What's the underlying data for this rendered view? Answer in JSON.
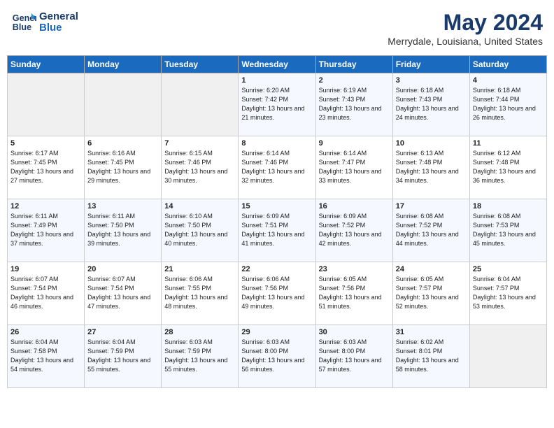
{
  "header": {
    "logo_line1": "General",
    "logo_line2": "Blue",
    "title": "May 2024",
    "subtitle": "Merrydale, Louisiana, United States"
  },
  "days_of_week": [
    "Sunday",
    "Monday",
    "Tuesday",
    "Wednesday",
    "Thursday",
    "Friday",
    "Saturday"
  ],
  "weeks": [
    [
      {
        "day": "",
        "empty": true
      },
      {
        "day": "",
        "empty": true
      },
      {
        "day": "",
        "empty": true
      },
      {
        "day": "1",
        "sunrise": "6:20 AM",
        "sunset": "7:42 PM",
        "daylight": "13 hours and 21 minutes."
      },
      {
        "day": "2",
        "sunrise": "6:19 AM",
        "sunset": "7:43 PM",
        "daylight": "13 hours and 23 minutes."
      },
      {
        "day": "3",
        "sunrise": "6:18 AM",
        "sunset": "7:43 PM",
        "daylight": "13 hours and 24 minutes."
      },
      {
        "day": "4",
        "sunrise": "6:18 AM",
        "sunset": "7:44 PM",
        "daylight": "13 hours and 26 minutes."
      }
    ],
    [
      {
        "day": "5",
        "sunrise": "6:17 AM",
        "sunset": "7:45 PM",
        "daylight": "13 hours and 27 minutes."
      },
      {
        "day": "6",
        "sunrise": "6:16 AM",
        "sunset": "7:45 PM",
        "daylight": "13 hours and 29 minutes."
      },
      {
        "day": "7",
        "sunrise": "6:15 AM",
        "sunset": "7:46 PM",
        "daylight": "13 hours and 30 minutes."
      },
      {
        "day": "8",
        "sunrise": "6:14 AM",
        "sunset": "7:46 PM",
        "daylight": "13 hours and 32 minutes."
      },
      {
        "day": "9",
        "sunrise": "6:14 AM",
        "sunset": "7:47 PM",
        "daylight": "13 hours and 33 minutes."
      },
      {
        "day": "10",
        "sunrise": "6:13 AM",
        "sunset": "7:48 PM",
        "daylight": "13 hours and 34 minutes."
      },
      {
        "day": "11",
        "sunrise": "6:12 AM",
        "sunset": "7:48 PM",
        "daylight": "13 hours and 36 minutes."
      }
    ],
    [
      {
        "day": "12",
        "sunrise": "6:11 AM",
        "sunset": "7:49 PM",
        "daylight": "13 hours and 37 minutes."
      },
      {
        "day": "13",
        "sunrise": "6:11 AM",
        "sunset": "7:50 PM",
        "daylight": "13 hours and 39 minutes."
      },
      {
        "day": "14",
        "sunrise": "6:10 AM",
        "sunset": "7:50 PM",
        "daylight": "13 hours and 40 minutes."
      },
      {
        "day": "15",
        "sunrise": "6:09 AM",
        "sunset": "7:51 PM",
        "daylight": "13 hours and 41 minutes."
      },
      {
        "day": "16",
        "sunrise": "6:09 AM",
        "sunset": "7:52 PM",
        "daylight": "13 hours and 42 minutes."
      },
      {
        "day": "17",
        "sunrise": "6:08 AM",
        "sunset": "7:52 PM",
        "daylight": "13 hours and 44 minutes."
      },
      {
        "day": "18",
        "sunrise": "6:08 AM",
        "sunset": "7:53 PM",
        "daylight": "13 hours and 45 minutes."
      }
    ],
    [
      {
        "day": "19",
        "sunrise": "6:07 AM",
        "sunset": "7:54 PM",
        "daylight": "13 hours and 46 minutes."
      },
      {
        "day": "20",
        "sunrise": "6:07 AM",
        "sunset": "7:54 PM",
        "daylight": "13 hours and 47 minutes."
      },
      {
        "day": "21",
        "sunrise": "6:06 AM",
        "sunset": "7:55 PM",
        "daylight": "13 hours and 48 minutes."
      },
      {
        "day": "22",
        "sunrise": "6:06 AM",
        "sunset": "7:56 PM",
        "daylight": "13 hours and 49 minutes."
      },
      {
        "day": "23",
        "sunrise": "6:05 AM",
        "sunset": "7:56 PM",
        "daylight": "13 hours and 51 minutes."
      },
      {
        "day": "24",
        "sunrise": "6:05 AM",
        "sunset": "7:57 PM",
        "daylight": "13 hours and 52 minutes."
      },
      {
        "day": "25",
        "sunrise": "6:04 AM",
        "sunset": "7:57 PM",
        "daylight": "13 hours and 53 minutes."
      }
    ],
    [
      {
        "day": "26",
        "sunrise": "6:04 AM",
        "sunset": "7:58 PM",
        "daylight": "13 hours and 54 minutes."
      },
      {
        "day": "27",
        "sunrise": "6:04 AM",
        "sunset": "7:59 PM",
        "daylight": "13 hours and 55 minutes."
      },
      {
        "day": "28",
        "sunrise": "6:03 AM",
        "sunset": "7:59 PM",
        "daylight": "13 hours and 55 minutes."
      },
      {
        "day": "29",
        "sunrise": "6:03 AM",
        "sunset": "8:00 PM",
        "daylight": "13 hours and 56 minutes."
      },
      {
        "day": "30",
        "sunrise": "6:03 AM",
        "sunset": "8:00 PM",
        "daylight": "13 hours and 57 minutes."
      },
      {
        "day": "31",
        "sunrise": "6:02 AM",
        "sunset": "8:01 PM",
        "daylight": "13 hours and 58 minutes."
      },
      {
        "day": "",
        "empty": true
      }
    ]
  ]
}
